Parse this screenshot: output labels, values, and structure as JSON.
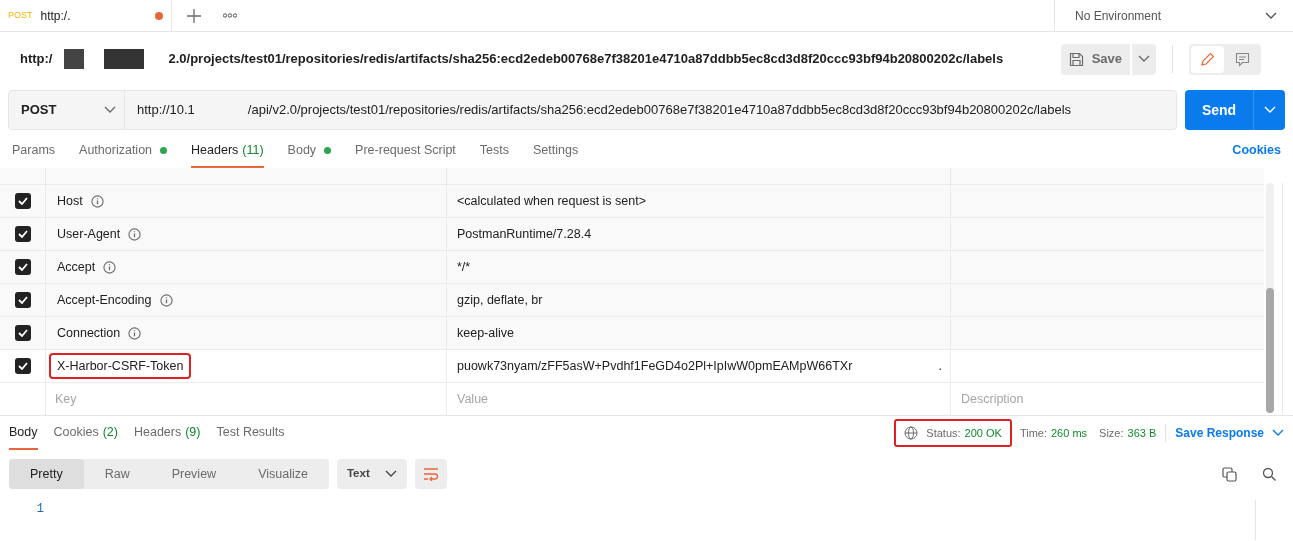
{
  "tabs": [
    {
      "method": "POST",
      "title": "http:/.",
      "unsaved": true,
      "selected": true
    }
  ],
  "environment": "No Environment",
  "request_title": {
    "start": "http:/",
    "end": "2.0/projects/test01/repositories/redis/artifacts/sha256:ecd2edeb00768e7f38201e4710a87ddbb5ec8cd3d8f20ccc93bf94b20800202c/labels"
  },
  "save_button": "Save",
  "request": {
    "method": "POST",
    "url_start": "http://10.1",
    "url_end": "/api/v2.0/projects/test01/repositories/redis/artifacts/sha256:ecd2edeb00768e7f38201e4710a87ddbb5ec8cd3d8f20ccc93bf94b20800202c/labels",
    "send": "Send"
  },
  "request_tabs": [
    {
      "label": "Params",
      "selected": false
    },
    {
      "label": "Authorization",
      "dot": true,
      "selected": false
    },
    {
      "label": "Headers",
      "count": "(11)",
      "selected": true
    },
    {
      "label": "Body",
      "dot": true,
      "selected": false
    },
    {
      "label": "Pre-request Script",
      "selected": false
    },
    {
      "label": "Tests",
      "selected": false
    },
    {
      "label": "Settings",
      "selected": false
    }
  ],
  "cookies_link": "Cookies",
  "headers": [
    {
      "key": "Host",
      "value": "<calculated when request is sent>",
      "checked": true,
      "info": true,
      "highlighted": false
    },
    {
      "key": "User-Agent",
      "value": "PostmanRuntime/7.28.4",
      "checked": true,
      "info": true,
      "highlighted": false
    },
    {
      "key": "Accept",
      "value": "*/*",
      "checked": true,
      "info": true,
      "highlighted": false
    },
    {
      "key": "Accept-Encoding",
      "value": "gzip, deflate, br",
      "checked": true,
      "info": true,
      "highlighted": false
    },
    {
      "key": "Connection",
      "value": "keep-alive",
      "checked": true,
      "info": true,
      "highlighted": false
    },
    {
      "key": "X-Harbor-CSRF-Token",
      "value": "puowk73nyam/zFF5asW+Pvdhf1FeGD4o2Pl+IpIwW0pmEAMpW66TXr",
      "value_tail": ".",
      "checked": true,
      "highlighted": true
    }
  ],
  "new_header": {
    "key_placeholder": "Key",
    "value_placeholder": "Value",
    "description_placeholder": "Description"
  },
  "response_tabs": [
    {
      "label": "Body",
      "selected": true
    },
    {
      "label": "Cookies",
      "count": "(2)",
      "selected": false
    },
    {
      "label": "Headers",
      "count": "(9)",
      "selected": false
    },
    {
      "label": "Test Results",
      "selected": false
    }
  ],
  "status": {
    "label": "Status:",
    "value": "200 OK",
    "highlighted": true
  },
  "time": {
    "label": "Time:",
    "value": "260 ms"
  },
  "size": {
    "label": "Size:",
    "value": "363 B"
  },
  "save_response": "Save Response",
  "view_modes": [
    {
      "label": "Pretty",
      "selected": true
    },
    {
      "label": "Raw",
      "selected": false
    },
    {
      "label": "Preview",
      "selected": false
    },
    {
      "label": "Visualize",
      "selected": false
    }
  ],
  "format": "Text",
  "line_numbers": [
    "1"
  ]
}
